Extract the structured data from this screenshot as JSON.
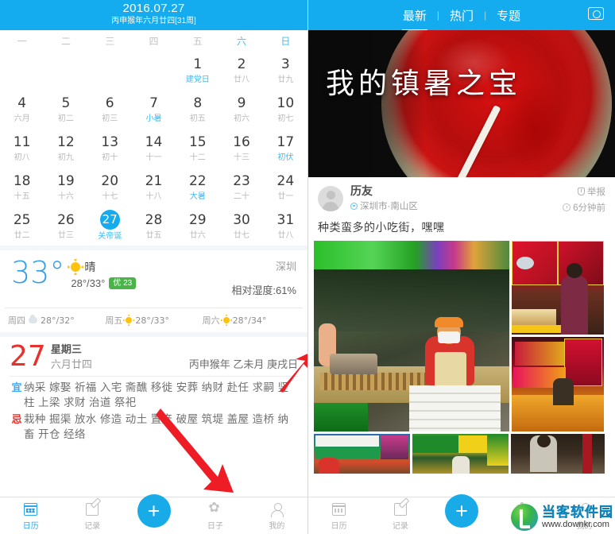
{
  "left": {
    "header": {
      "date_main": "2016.07.27",
      "date_sub": "丙申猴年六月廿四[31周]"
    },
    "weekdays": [
      {
        "label": "一",
        "weekend": false
      },
      {
        "label": "二",
        "weekend": false
      },
      {
        "label": "三",
        "weekend": false
      },
      {
        "label": "四",
        "weekend": false
      },
      {
        "label": "五",
        "weekend": false
      },
      {
        "label": "六",
        "weekend": true
      },
      {
        "label": "日",
        "weekend": true
      }
    ],
    "weeks": [
      [
        {
          "num": "",
          "lunar": "",
          "blank": true
        },
        {
          "num": "",
          "lunar": "",
          "blank": true
        },
        {
          "num": "",
          "lunar": "",
          "blank": true
        },
        {
          "num": "",
          "lunar": "",
          "blank": true
        },
        {
          "num": "1",
          "lunar": "建党日",
          "festive": true
        },
        {
          "num": "2",
          "lunar": "廿八"
        },
        {
          "num": "3",
          "lunar": "廿九"
        }
      ],
      [
        {
          "num": "4",
          "lunar": "六月"
        },
        {
          "num": "5",
          "lunar": "初二"
        },
        {
          "num": "6",
          "lunar": "初三"
        },
        {
          "num": "7",
          "lunar": "小暑",
          "festive": true
        },
        {
          "num": "8",
          "lunar": "初五"
        },
        {
          "num": "9",
          "lunar": "初六"
        },
        {
          "num": "10",
          "lunar": "初七"
        }
      ],
      [
        {
          "num": "11",
          "lunar": "初八"
        },
        {
          "num": "12",
          "lunar": "初九"
        },
        {
          "num": "13",
          "lunar": "初十"
        },
        {
          "num": "14",
          "lunar": "十一"
        },
        {
          "num": "15",
          "lunar": "十二"
        },
        {
          "num": "16",
          "lunar": "十三"
        },
        {
          "num": "17",
          "lunar": "初伏",
          "festive": true
        }
      ],
      [
        {
          "num": "18",
          "lunar": "十五"
        },
        {
          "num": "19",
          "lunar": "十六"
        },
        {
          "num": "20",
          "lunar": "十七"
        },
        {
          "num": "21",
          "lunar": "十八"
        },
        {
          "num": "22",
          "lunar": "大暑",
          "festive": true
        },
        {
          "num": "23",
          "lunar": "二十"
        },
        {
          "num": "24",
          "lunar": "廿一"
        }
      ],
      [
        {
          "num": "25",
          "lunar": "廿二"
        },
        {
          "num": "26",
          "lunar": "廿三"
        },
        {
          "num": "27",
          "lunar": "关帝诞",
          "today": true
        },
        {
          "num": "28",
          "lunar": "廿五"
        },
        {
          "num": "29",
          "lunar": "廿六"
        },
        {
          "num": "30",
          "lunar": "廿七"
        },
        {
          "num": "31",
          "lunar": "廿八"
        }
      ]
    ],
    "weather": {
      "temp": "33°",
      "condition": "晴",
      "range": "28°/33°",
      "aqi": "优 23",
      "city": "深圳",
      "humidity": "相对湿度:61%",
      "forecast": [
        {
          "day": "周四",
          "icon": "cloud-icon",
          "temp": "28°/32°"
        },
        {
          "day": "周五",
          "icon": "sun-icon",
          "temp": "28°/33°"
        },
        {
          "day": "周六",
          "icon": "sun-icon",
          "temp": "28°/34°"
        }
      ]
    },
    "almanac": {
      "day": "27",
      "weekday": "星期三",
      "lunar": "六月廿四",
      "ganzhi": "丙申猴年 乙未月 庚戌日",
      "yi_key": "宜",
      "yi_value": "纳采 嫁娶 祈福 入宅 斋醮 移徙 安葬 纳财 赴任 求嗣 竖柱 上梁 求财 治道 祭祀",
      "ji_key": "忌",
      "ji_value": "栽种 掘渠 放水 修造 动土 置产 破屋 筑堤 盖屋 造桥 纳畜 开仓 经络"
    },
    "tabs": [
      {
        "label": "日历",
        "icon": "calendar-icon",
        "active": true
      },
      {
        "label": "记录",
        "icon": "note-icon",
        "active": false
      },
      {
        "label": "日子",
        "icon": "flower-icon",
        "active": false
      },
      {
        "label": "我的",
        "icon": "person-icon",
        "active": false
      }
    ],
    "fab_label": "+"
  },
  "right": {
    "tabs": [
      {
        "label": "最新",
        "active": true
      },
      {
        "label": "热门",
        "active": false
      },
      {
        "label": "专题",
        "active": false
      }
    ],
    "tab_divider": "|",
    "camera_icon": "camera-icon",
    "banner": {
      "title": "我的镇暑之宝"
    },
    "post": {
      "author": "历友",
      "location": "深圳市·南山区",
      "report": "举报",
      "time": "6分钟前",
      "text": "种类蛮多的小吃街，嘿嘿"
    },
    "tabs_bottom": [
      {
        "label": "日历",
        "icon": "calendar-icon",
        "active": false
      },
      {
        "label": "记录",
        "icon": "note-icon",
        "active": false
      },
      {
        "label": "日子",
        "icon": "flower-icon",
        "active": false
      },
      {
        "label": "我的",
        "icon": "person-icon",
        "active": false
      }
    ],
    "fab_label": "+",
    "watermark": {
      "name": "当客软件园",
      "url": "www.downkr.com"
    }
  },
  "colors": {
    "accent": "#14ACEE",
    "red": "#E8312A",
    "green": "#49B549"
  }
}
